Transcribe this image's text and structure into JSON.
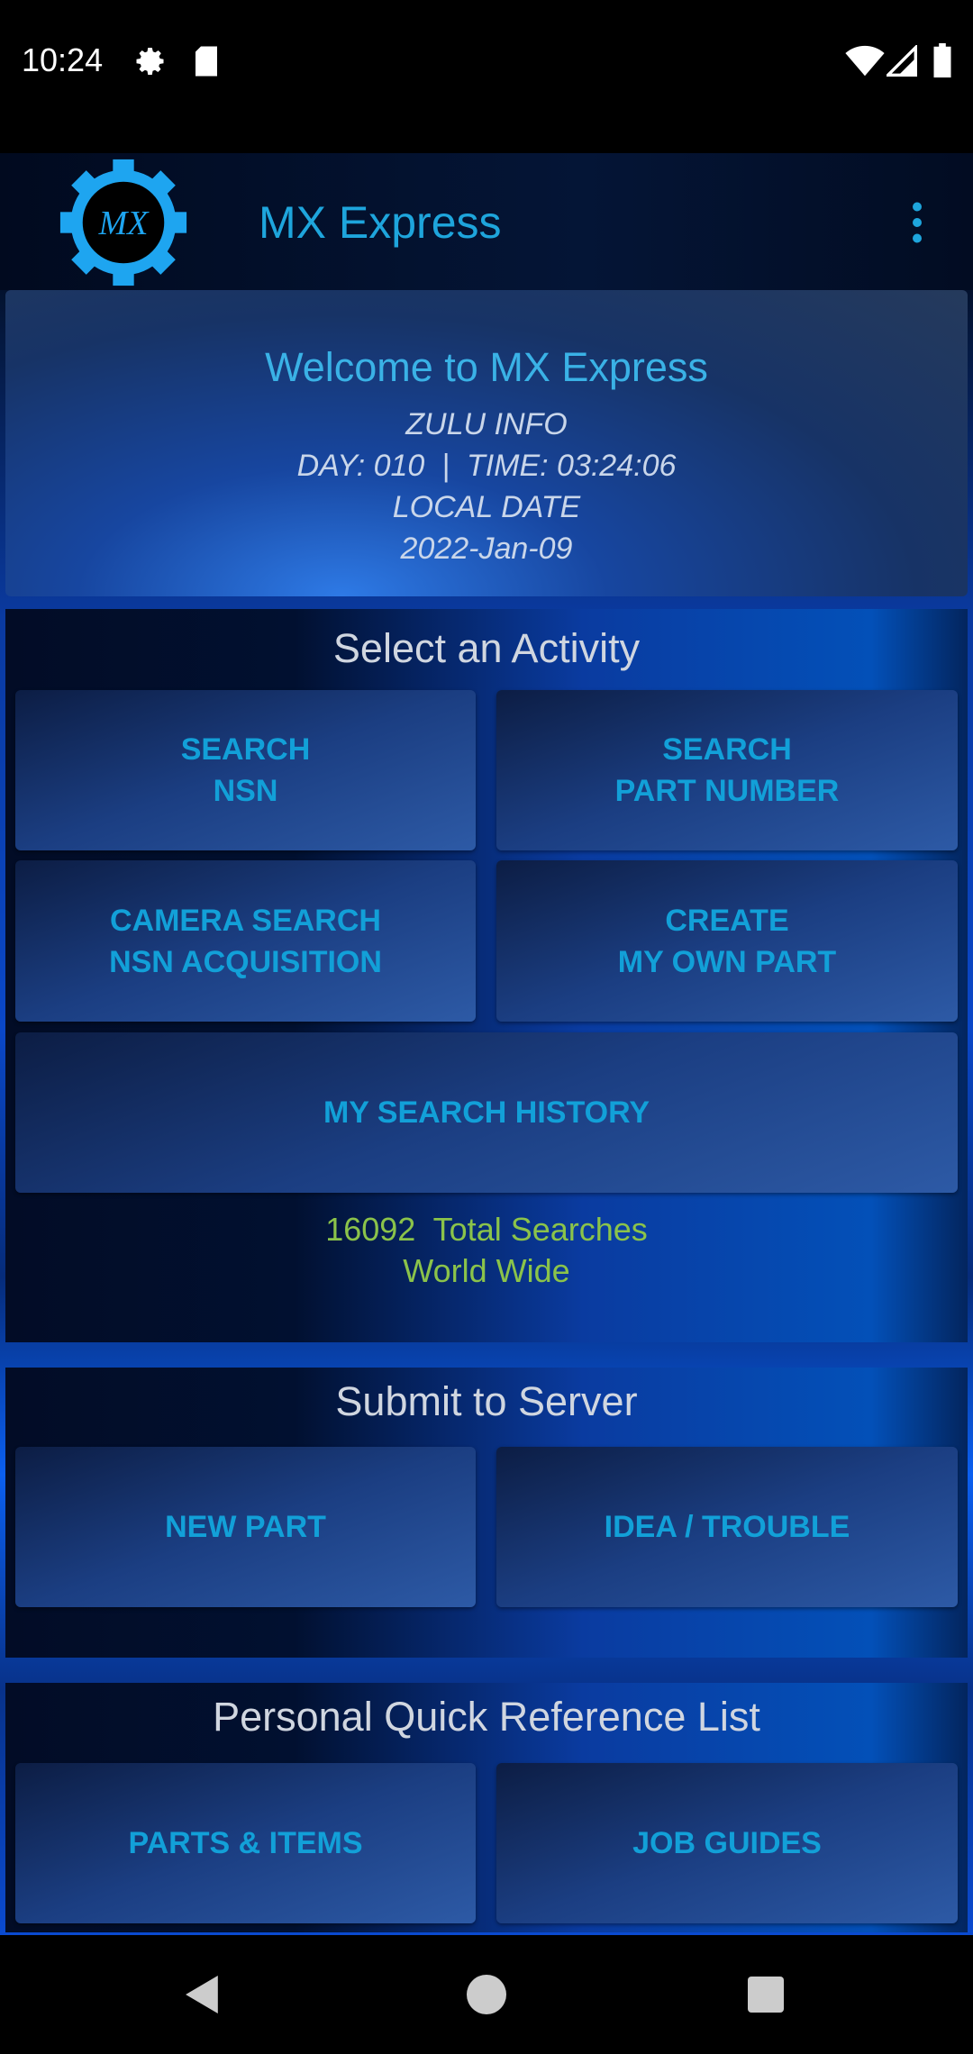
{
  "status_bar": {
    "time": "10:24",
    "icons": [
      "settings-icon",
      "sd-card-icon",
      "wifi-icon",
      "signal-icon",
      "battery-icon"
    ]
  },
  "app_bar": {
    "title": "MX Express",
    "logo_text": "MX",
    "menu_icon": "more-vert-icon"
  },
  "welcome": {
    "title": "Welcome to MX Express",
    "zulu_label": "ZULU INFO",
    "zulu_line": "DAY: 010  |  TIME: 03:24:06",
    "local_label": "LOCAL DATE",
    "local_date": "2022-Jan-09"
  },
  "activity": {
    "title": "Select an Activity",
    "buttons": [
      {
        "line1": "SEARCH",
        "line2": "NSN"
      },
      {
        "line1": "SEARCH",
        "line2": "PART NUMBER"
      },
      {
        "line1": "CAMERA SEARCH",
        "line2": "NSN ACQUISITION"
      },
      {
        "line1": "CREATE",
        "line2": "MY OWN PART"
      }
    ],
    "history": "MY SEARCH HISTORY",
    "total_line": "16092  Total Searches",
    "world_wide": "World Wide"
  },
  "submit": {
    "title": "Submit to Server",
    "buttons": [
      "NEW PART",
      "IDEA / TROUBLE"
    ]
  },
  "reference": {
    "title": "Personal Quick Reference List",
    "buttons": [
      "PARTS & ITEMS",
      "JOB GUIDES"
    ]
  },
  "colors": {
    "accent": "#1ea5dc",
    "stat_green": "#8bc34a"
  }
}
